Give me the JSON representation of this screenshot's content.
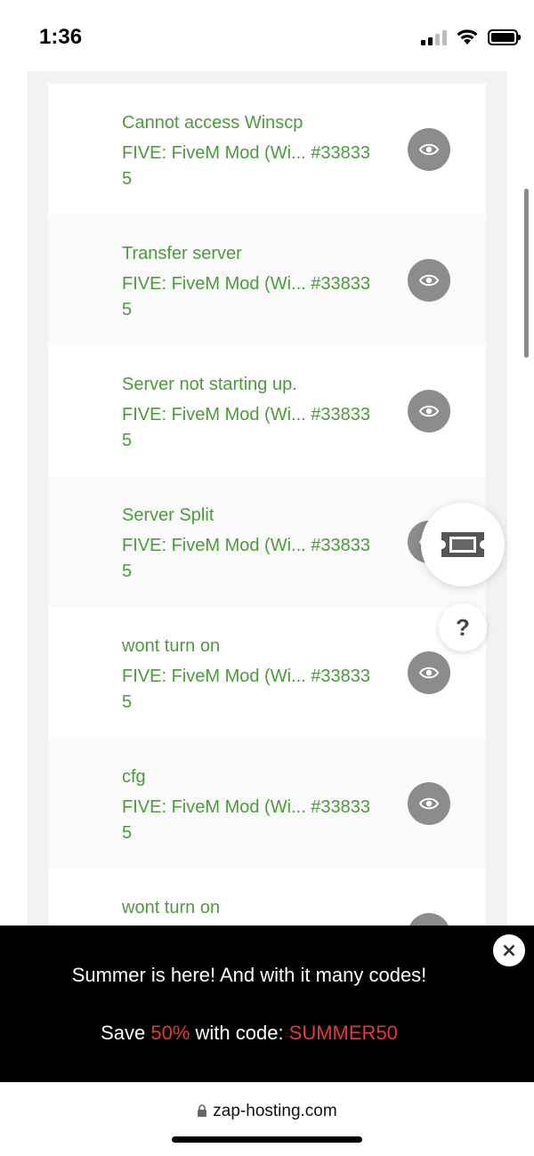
{
  "status": {
    "time": "1:36"
  },
  "tickets": [
    {
      "title": "Cannot access Winscp",
      "subtitle": "FIVE: FiveM Mod (Wi... #338335"
    },
    {
      "title": "Transfer server",
      "subtitle": "FIVE: FiveM Mod (Wi... #338335"
    },
    {
      "title": "Server not starting up.",
      "subtitle": "FIVE: FiveM Mod (Wi... #338335"
    },
    {
      "title": "Server Split",
      "subtitle": "FIVE: FiveM Mod (Wi... #338335"
    },
    {
      "title": "wont turn on",
      "subtitle": "FIVE: FiveM Mod (Wi... #338335"
    },
    {
      "title": "cfg",
      "subtitle": "FIVE: FiveM Mod (Wi... #338335"
    },
    {
      "title": "wont turn on",
      "subtitle": ""
    }
  ],
  "help_button": {
    "label": "?"
  },
  "promo": {
    "line1": "Summer is here! And with it many codes!",
    "save_prefix": "Save ",
    "percent": "50%",
    "with_code": " with code: ",
    "code": "SUMMER50",
    "close_label": "×"
  },
  "browser": {
    "url": "zap-hosting.com"
  },
  "colors": {
    "accent_green": "#4c9b3c",
    "promo_red": "#e53935",
    "eye_button": "#8c8c8c"
  },
  "icons": {
    "view": "eye-icon",
    "ticket": "ticket-icon",
    "help": "question-icon",
    "close": "close-icon",
    "lock": "lock-icon"
  }
}
